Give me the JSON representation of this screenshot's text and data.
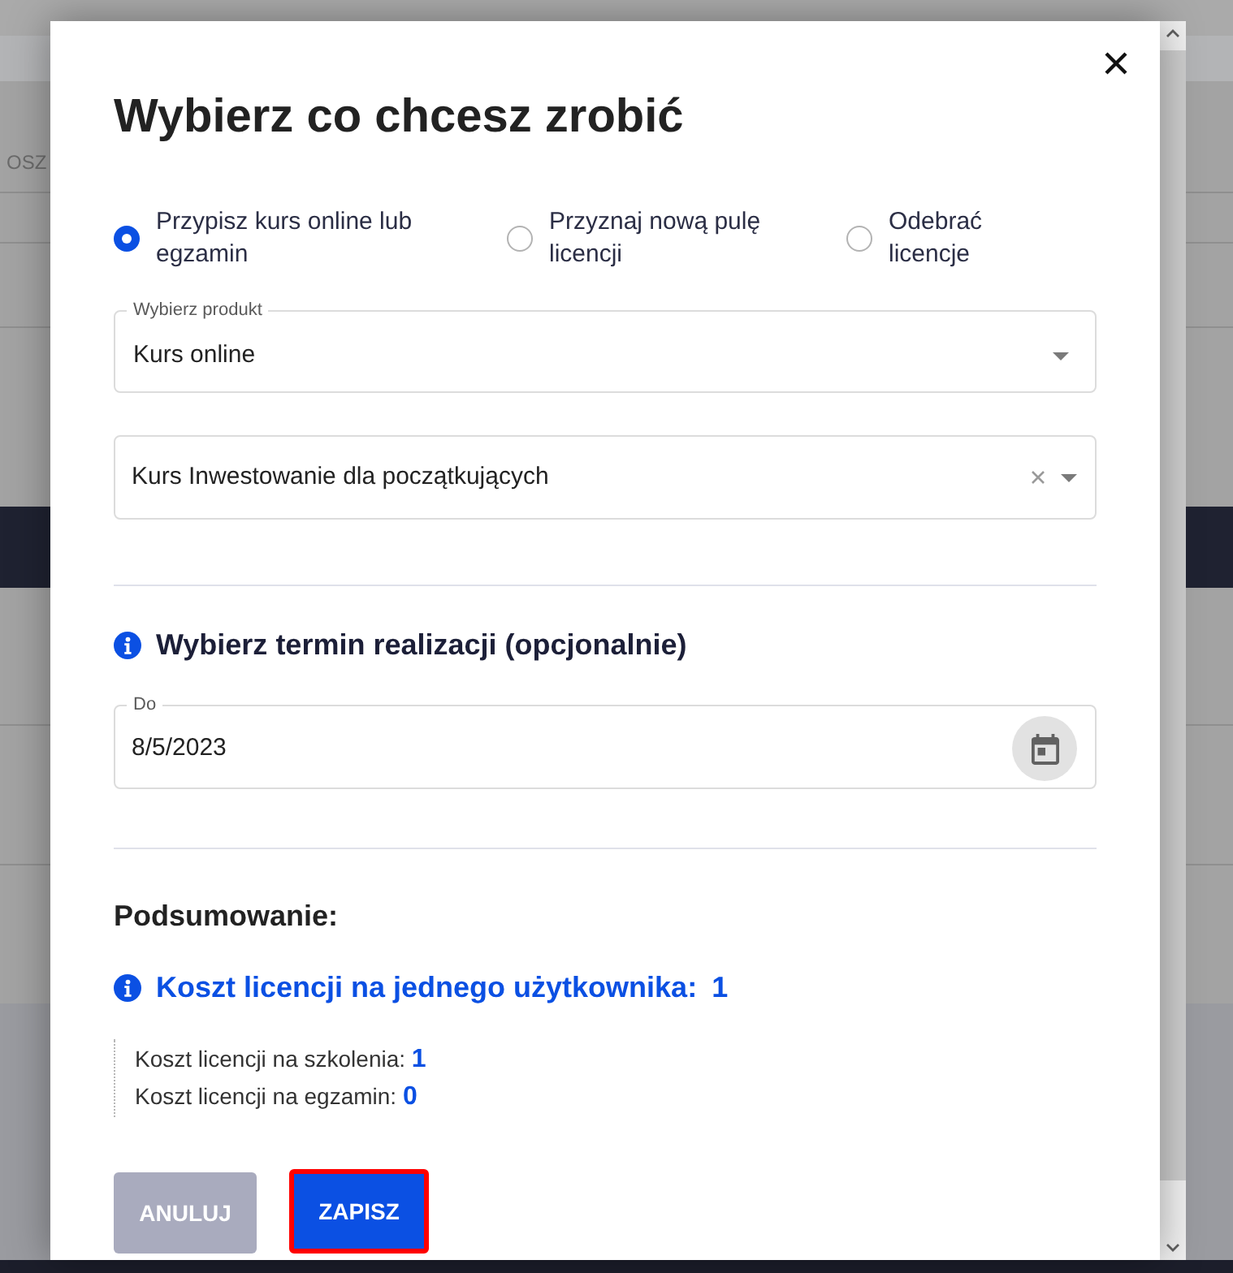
{
  "background": {
    "heading_fragment": "OSZ"
  },
  "dialog": {
    "title": "Wybierz co chcesz zrobić",
    "options": [
      {
        "label": "Przypisz kurs online lub egzamin",
        "selected": true
      },
      {
        "label": "Przyznaj nową pulę licencji",
        "selected": false
      },
      {
        "label": "Odebrać licencje",
        "selected": false
      }
    ],
    "product_select": {
      "label": "Wybierz produkt",
      "value": "Kurs online"
    },
    "course_select": {
      "value": "Kurs Inwestowanie dla początkujących"
    },
    "deadline": {
      "heading": "Wybierz termin realizacji (opcjonalnie)",
      "field_label": "Do",
      "value": "8/5/2023"
    },
    "summary": {
      "heading": "Podsumowanie:",
      "total_label": "Koszt licencji na jednego użytkownika:",
      "total_value": "1",
      "items": [
        {
          "label": "Koszt licencji na szkolenia:",
          "value": "1"
        },
        {
          "label": "Koszt licencji na egzamin:",
          "value": "0"
        }
      ]
    },
    "buttons": [
      {
        "label": "ANULUJ",
        "kind": "cancel",
        "focused": false
      },
      {
        "label": "ZAPISZ",
        "kind": "save",
        "focused": true
      }
    ]
  }
}
